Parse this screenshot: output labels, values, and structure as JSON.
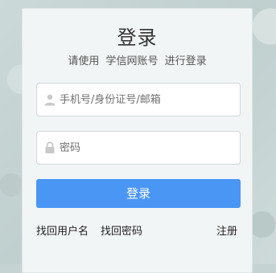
{
  "login": {
    "title": "登录",
    "subtitle": [
      "请使用",
      "学信网账号",
      "进行登录"
    ],
    "username": {
      "placeholder": "手机号/身份证号/邮箱",
      "value": "",
      "icon": "user-icon"
    },
    "password": {
      "placeholder": "密码",
      "value": "",
      "icon": "lock-icon"
    },
    "submit_label": "登录",
    "links": {
      "find_username": "找回用户名",
      "find_password": "找回密码",
      "register": "注册"
    },
    "colors": {
      "primary": "#4a96f4",
      "panel": "#f2f5f6"
    }
  }
}
